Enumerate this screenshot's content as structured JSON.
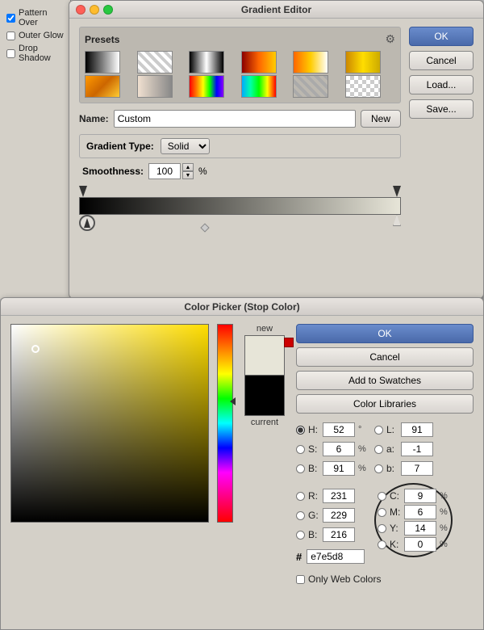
{
  "gradient_editor": {
    "title": "Gradient Editor",
    "presets_label": "Presets",
    "name_label": "Name:",
    "name_value": "Custom",
    "new_btn": "New",
    "ok_btn": "OK",
    "cancel_btn": "Cancel",
    "load_btn": "Load...",
    "save_btn": "Save...",
    "gradient_type_label": "Gradient Type:",
    "gradient_type_value": "Solid",
    "smoothness_label": "Smoothness:",
    "smoothness_value": "100",
    "smoothness_unit": "%"
  },
  "color_picker": {
    "title": "Color Picker (Stop Color)",
    "ok_btn": "OK",
    "cancel_btn": "Cancel",
    "add_to_swatches_btn": "Add to Swatches",
    "color_libraries_btn": "Color Libraries",
    "new_label": "new",
    "current_label": "current",
    "only_web_colors": "Only Web Colors",
    "fields": {
      "H_label": "H:",
      "H_value": "52",
      "H_unit": "°",
      "S_label": "S:",
      "S_value": "6",
      "S_unit": "%",
      "B_label": "B:",
      "B_value": "91",
      "B_unit": "%",
      "R_label": "R:",
      "R_value": "231",
      "G_label": "G:",
      "G_value": "229",
      "Bfield_label": "B:",
      "Bfield_value": "216",
      "L_label": "L:",
      "L_value": "91",
      "a_label": "a:",
      "a_value": "-1",
      "b_label": "b:",
      "b_value": "7",
      "C_label": "C:",
      "C_value": "9",
      "C_unit": "%",
      "M_label": "M:",
      "M_value": "6",
      "M_unit": "%",
      "Y_label": "Y:",
      "Y_value": "14",
      "Y_unit": "%",
      "K_label": "K:",
      "K_value": "0",
      "K_unit": "%",
      "hex_label": "#",
      "hex_value": "e7e5d8"
    }
  },
  "left_panel": {
    "items": [
      {
        "label": "Pattern Over"
      },
      {
        "label": "Outer Glow"
      },
      {
        "label": "Drop Shadow"
      }
    ]
  }
}
